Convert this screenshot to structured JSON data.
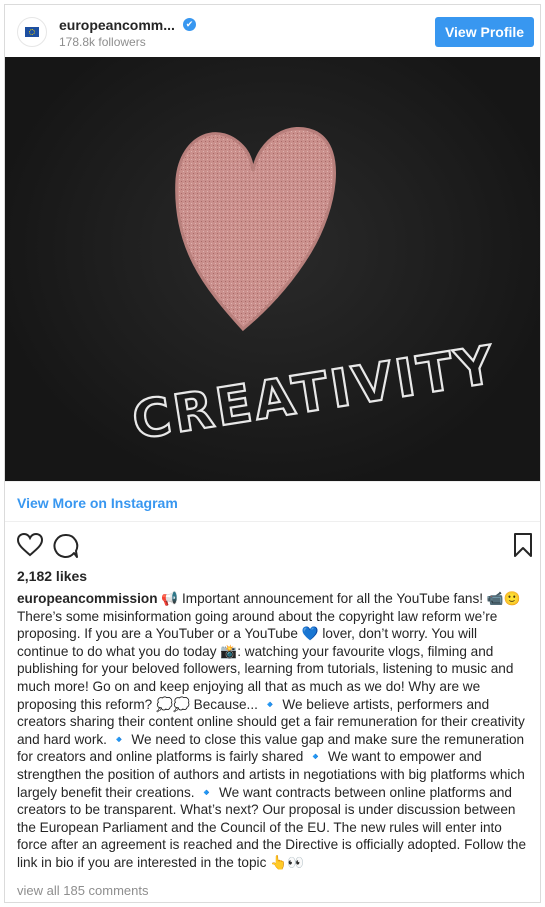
{
  "header": {
    "username": "europeancomm...",
    "followers": "178.8k followers",
    "view_profile": "View Profile"
  },
  "photo": {
    "chalk_text": "CREATIVITY"
  },
  "view_more": "View More on Instagram",
  "likes": "2,182 likes",
  "caption": {
    "username": "europeancommission",
    "text": " 📢 Important announcement for all the YouTube fans! 📹🙂 There’s some misinformation going around about the copyright law reform we’re proposing. If you are a YouTuber or a YouTube 💙 lover, don’t worry. You will continue to do what you do today 📸: watching your favourite vlogs, filming and publishing for your beloved followers, learning from tutorials, listening to music and much more! Go on and keep enjoying all that as much as we do! Why are we proposing this reform? 💭💭 Because... 🔹 We believe artists, performers and creators sharing their content online should get a fair remuneration for their creativity and hard work. 🔹 We need to close this value gap and make sure the remuneration for creators and online platforms is fairly shared 🔹 We want to empower and strengthen the position of authors and artists in negotiations with big platforms which largely benefit their creations. 🔹 We want contracts between online platforms and creators to be transparent. What’s next? Our proposal is under discussion between the European Parliament and the Council of the EU. The new rules will enter into force after an agreement is reached and the Directive is officially adopted. Follow the link in bio if you are interested in the topic 👆👀"
  },
  "comments": "view all 185 comments",
  "colors": {
    "accent": "#3897f0",
    "chalk_heart": "#d99a96",
    "chalk_text": "#e8e8e8"
  },
  "icons": {
    "avatar": "eu-flag-icon",
    "verified": "verified-badge-icon",
    "like": "heart-outline-icon",
    "comment": "comment-bubble-icon",
    "save": "bookmark-icon"
  }
}
